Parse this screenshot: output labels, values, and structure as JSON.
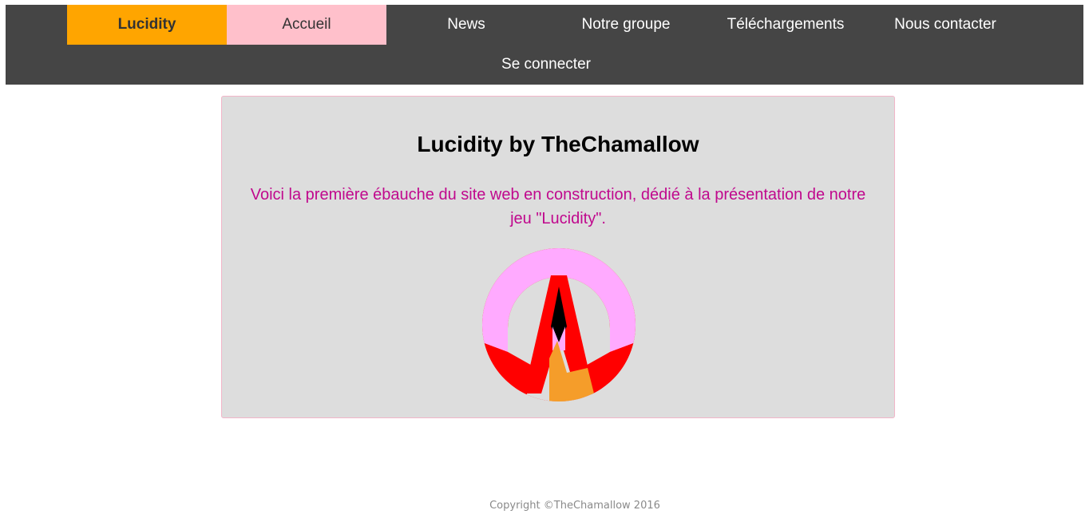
{
  "nav": {
    "brand": "Lucidity",
    "items": [
      {
        "label": "Accueil"
      },
      {
        "label": "News"
      },
      {
        "label": "Notre groupe"
      },
      {
        "label": "Téléchargements"
      },
      {
        "label": "Nous contacter"
      }
    ],
    "login": "Se connecter"
  },
  "main": {
    "title": "Lucidity by TheChamallow",
    "intro": "Voici la première ébauche du site web en construction, dédié à la présentation de notre jeu \"Lucidity\".",
    "logo_icon": "lucidity-logo"
  },
  "footer": {
    "copyright": "Copyright ©TheChamallow 2016"
  },
  "colors": {
    "navbar_bg": "#454545",
    "brand_bg": "#ffa500",
    "active_bg": "#ffc0cb",
    "card_bg": "#dddddd",
    "intro_text": "#c0088d"
  }
}
